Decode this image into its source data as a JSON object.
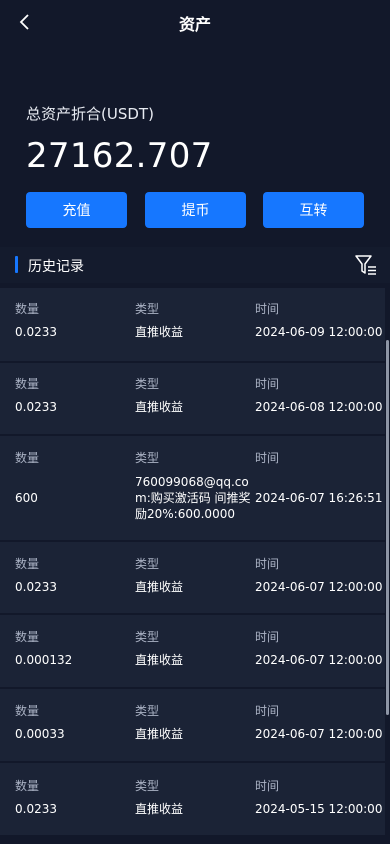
{
  "header": {
    "title": "资产",
    "back_icon": "chevron-left-icon"
  },
  "summary": {
    "label": "总资产折合(USDT)",
    "value": "27162.707"
  },
  "actions": {
    "deposit": "充值",
    "withdraw": "提币",
    "transfer": "互转"
  },
  "history": {
    "title": "历史记录",
    "filter_icon": "filter-icon"
  },
  "columns": {
    "amount": "数量",
    "type": "类型",
    "time": "时间"
  },
  "records": [
    {
      "amount": "0.0233",
      "type": "直推收益",
      "time": "2024-06-09 12:00:00"
    },
    {
      "amount": "0.0233",
      "type": "直推收益",
      "time": "2024-06-08 12:00:00"
    },
    {
      "amount": "600",
      "type": "760099068@qq.com:购买激活码 间推奖励20%:600.0000",
      "time": "2024-06-07 16:26:51"
    },
    {
      "amount": "0.0233",
      "type": "直推收益",
      "time": "2024-06-07 12:00:00"
    },
    {
      "amount": "0.000132",
      "type": "直推收益",
      "time": "2024-06-07 12:00:00"
    },
    {
      "amount": "0.00033",
      "type": "直推收益",
      "time": "2024-06-07 12:00:00"
    },
    {
      "amount": "0.0233",
      "type": "直推收益",
      "time": "2024-05-15 12:00:00"
    }
  ],
  "colors": {
    "background": "#12182a",
    "card": "#1b2336",
    "accent": "#1677ff",
    "muted_text": "#aab2c4"
  }
}
